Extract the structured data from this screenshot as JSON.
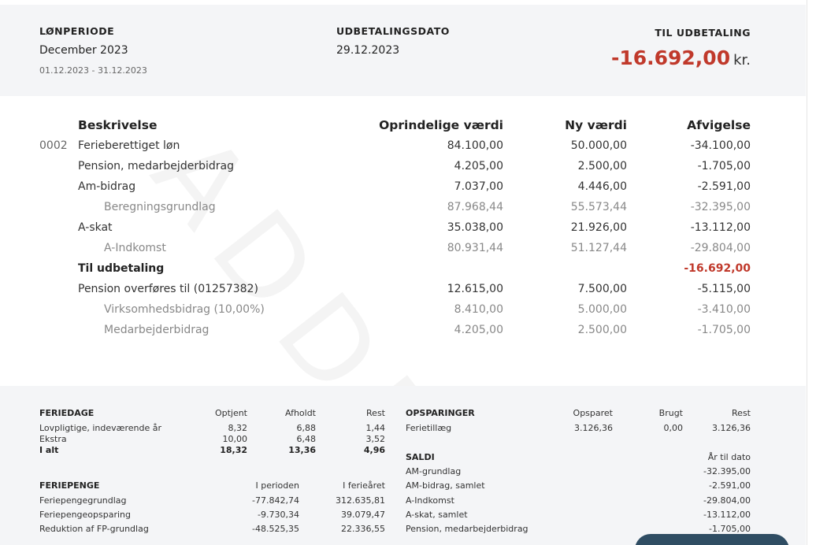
{
  "header": {
    "period_label": "LØNPERIODE",
    "period_value": "December 2023",
    "period_range": "01.12.2023 - 31.12.2023",
    "paydate_label": "UDBETALINGSDATO",
    "paydate_value": "29.12.2023",
    "payout_label": "TIL UDBETALING",
    "payout_amount": "-16.692,00",
    "payout_unit": "kr."
  },
  "watermark": "ADDE",
  "table": {
    "headers": {
      "desc": "Beskrivelse",
      "orig": "Oprindelige værdi",
      "new": "Ny værdi",
      "dev": "Afvigelse"
    },
    "rows": [
      {
        "code": "0002",
        "desc": "Ferieberettiget løn",
        "orig": "84.100,00",
        "new": "50.000,00",
        "dev": "-34.100,00"
      },
      {
        "code": "",
        "desc": "Pension, medarbejderbidrag",
        "orig": "4.205,00",
        "new": "2.500,00",
        "dev": "-1.705,00"
      },
      {
        "code": "",
        "desc": "Am-bidrag",
        "orig": "7.037,00",
        "new": "4.446,00",
        "dev": "-2.591,00"
      },
      {
        "code": "",
        "desc": "Beregningsgrundlag",
        "orig": "87.968,44",
        "new": "55.573,44",
        "dev": "-32.395,00"
      },
      {
        "code": "",
        "desc": "A-skat",
        "orig": "35.038,00",
        "new": "21.926,00",
        "dev": "-13.112,00"
      },
      {
        "code": "",
        "desc": "A-Indkomst",
        "orig": "80.931,44",
        "new": "51.127,44",
        "dev": "-29.804,00"
      },
      {
        "code": "",
        "desc": "Til udbetaling",
        "orig": "",
        "new": "",
        "dev": "-16.692,00"
      },
      {
        "code": "",
        "desc": "Pension overføres til (01257382)",
        "orig": "12.615,00",
        "new": "7.500,00",
        "dev": "-5.115,00"
      },
      {
        "code": "",
        "desc": "Virksomhedsbidrag (10,00%)",
        "orig": "8.410,00",
        "new": "5.000,00",
        "dev": "-3.410,00"
      },
      {
        "code": "",
        "desc": "Medarbejderbidrag",
        "orig": "4.205,00",
        "new": "2.500,00",
        "dev": "-1.705,00"
      }
    ]
  },
  "feriedage": {
    "title": "FERIEDAGE",
    "cols": [
      "Optjent",
      "Afholdt",
      "Rest"
    ],
    "rows": [
      {
        "label": "Lovpligtige, indeværende år",
        "v": [
          "8,32",
          "6,88",
          "1,44"
        ]
      },
      {
        "label": "Ekstra",
        "v": [
          "10,00",
          "6,48",
          "3,52"
        ]
      },
      {
        "label": "I alt",
        "v": [
          "18,32",
          "13,36",
          "4,96"
        ]
      }
    ]
  },
  "feriepenge": {
    "title": "FERIEPENGE",
    "cols": [
      "I perioden",
      "I ferieåret"
    ],
    "rows": [
      {
        "label": "Feriepengegrundlag",
        "v": [
          "-77.842,74",
          "312.635,81"
        ]
      },
      {
        "label": "Feriepengeopsparing",
        "v": [
          "-9.730,34",
          "39.079,47"
        ]
      },
      {
        "label": "Reduktion af FP-grundlag",
        "v": [
          "-48.525,35",
          "22.336,55"
        ]
      }
    ]
  },
  "opsparinger": {
    "title": "OPSPARINGER",
    "cols": [
      "Opsparet",
      "Brugt",
      "Rest"
    ],
    "rows": [
      {
        "label": "Ferietillæg",
        "v": [
          "3.126,36",
          "0,00",
          "3.126,36"
        ]
      }
    ]
  },
  "saldi": {
    "title": "SALDI",
    "col": "År til dato",
    "rows": [
      {
        "label": "AM-grundlag",
        "v": "-32.395,00"
      },
      {
        "label": "AM-bidrag, samlet",
        "v": "-2.591,00"
      },
      {
        "label": "A-Indkomst",
        "v": "-29.804,00"
      },
      {
        "label": "A-skat, samlet",
        "v": "-13.112,00"
      },
      {
        "label": "Pension, medarbejderbidrag",
        "v": "-1.705,00"
      }
    ]
  }
}
